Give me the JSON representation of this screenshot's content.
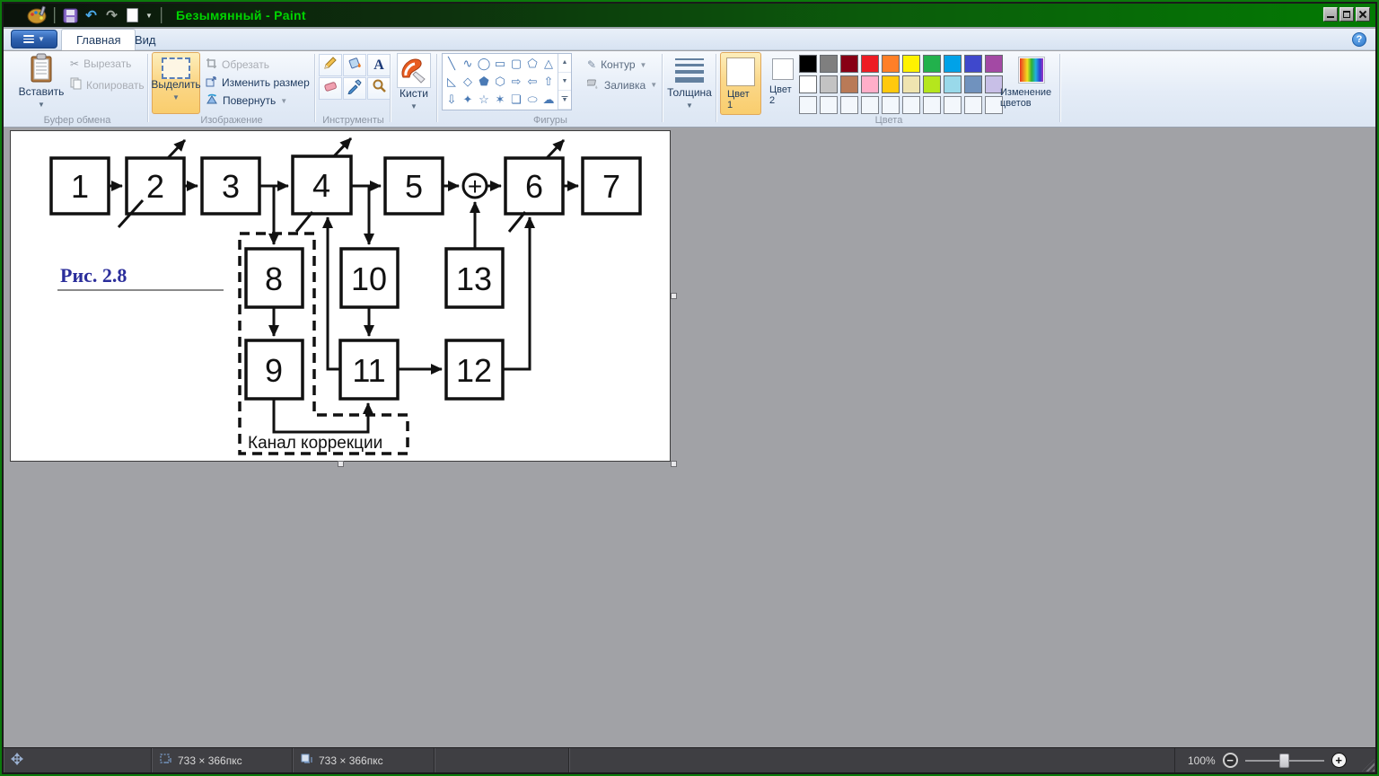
{
  "titlebar": {
    "title": "Безымянный - Paint"
  },
  "tabs": {
    "home": "Главная",
    "view": "Вид"
  },
  "ribbon": {
    "clipboard": {
      "caption": "Буфер обмена",
      "paste": "Вставить",
      "cut": "Вырезать",
      "copy": "Копировать"
    },
    "image": {
      "caption": "Изображение",
      "select": "Выделить",
      "crop": "Обрезать",
      "resize": "Изменить размер",
      "rotate": "Повернуть"
    },
    "tools": {
      "caption": "Инструменты",
      "text_tool": "A"
    },
    "brushes": {
      "label": "Кисти"
    },
    "shapes": {
      "caption": "Фигуры",
      "outline": "Контур",
      "fill": "Заливка",
      "glyphs": [
        "╲",
        "∿",
        "◯",
        "▭",
        "▢",
        "⬠",
        "△",
        "◺",
        "◇",
        "⬟",
        "⬡",
        "⇨",
        "⇦",
        "⇧",
        "⇩",
        "✦",
        "☆",
        "✶",
        "❏",
        "⬭",
        "☁"
      ],
      "scroll_up": "▲",
      "scroll_down": "▼",
      "scroll_more": "▼"
    },
    "size": {
      "label": "Толщина"
    },
    "colors": {
      "caption": "Цвета",
      "color1": "Цвет 1",
      "color2": "Цвет 2",
      "edit_colors": "Изменение цветов",
      "color1_value": "#ffffff",
      "color2_value": "#ffffff",
      "row1": [
        "#000000",
        "#7f7f7f",
        "#880015",
        "#ed1c24",
        "#ff7f27",
        "#fff200",
        "#22b14c",
        "#00a2e8",
        "#3f48cc",
        "#a349a4"
      ],
      "row2": [
        "#ffffff",
        "#c3c3c3",
        "#b97a57",
        "#ffaec9",
        "#ffc90e",
        "#efe4b0",
        "#b5e61d",
        "#99d9ea",
        "#7092be",
        "#c8bfe7"
      ],
      "empty_count": 10
    }
  },
  "diagram": {
    "b1": "1",
    "b2": "2",
    "b3": "3",
    "b4": "4",
    "b5": "5",
    "b6": "6",
    "b7": "7",
    "b8": "8",
    "b9": "9",
    "b10": "10",
    "b11": "11",
    "b12": "12",
    "b13": "13",
    "sum": "+",
    "figure_label": "Рис. 2.8",
    "channel_label": "Канал коррекции",
    "figure_color": "#2b2e9b"
  },
  "status": {
    "selection_size": "733 × 366пкс",
    "image_size": "733 × 366пкс",
    "zoom": "100%"
  }
}
